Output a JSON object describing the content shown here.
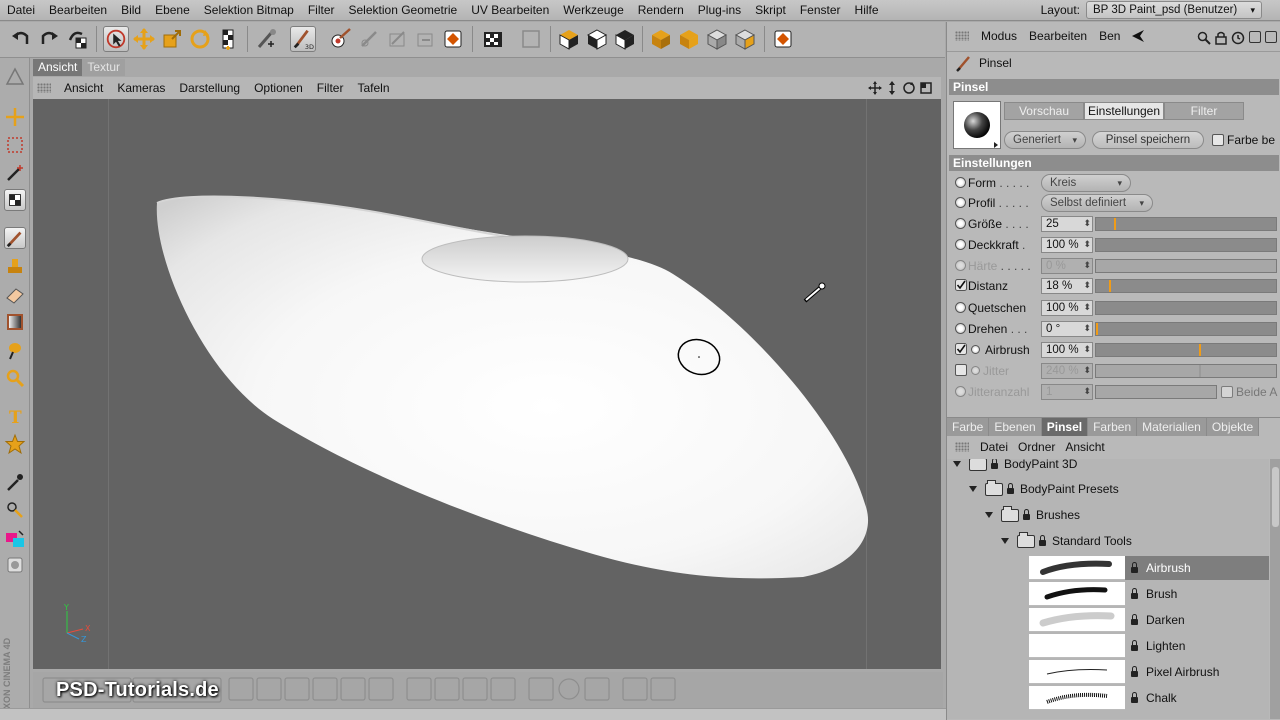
{
  "menubar": {
    "items": [
      "Datei",
      "Bearbeiten",
      "Bild",
      "Ebene",
      "Selektion Bitmap",
      "Filter",
      "Selektion Geometrie",
      "UV Bearbeiten",
      "Werkzeuge",
      "Rendern",
      "Plug-ins",
      "Skript",
      "Fenster",
      "Hilfe"
    ],
    "layout_label": "Layout:",
    "layout_value": "BP 3D Paint_psd (Benutzer)"
  },
  "viewport": {
    "tabs": [
      "Ansicht",
      "Textur"
    ],
    "menu": [
      "Ansicht",
      "Kameras",
      "Darstellung",
      "Optionen",
      "Filter",
      "Tafeln"
    ],
    "axis": {
      "y": "Y",
      "x": "X",
      "z": "Z"
    }
  },
  "left_brand": "MAXON CINEMA 4D",
  "watermark": "PSD-Tutorials.de",
  "attributes": {
    "menu": [
      "Modus",
      "Bearbeiten",
      "Ben"
    ],
    "tool_title": "Pinsel",
    "section_title": "Pinsel",
    "tabs": [
      "Vorschau",
      "Einstellungen",
      "Filter"
    ],
    "generated_dropdown": "Generiert",
    "save_button": "Pinsel speichern",
    "color_checkbox": "Farbe be",
    "settings_title": "Einstellungen",
    "params": {
      "form": {
        "label": "Form",
        "dots": " . . . . .",
        "value": "Kreis"
      },
      "profil": {
        "label": "Profil",
        "dots": " . . . . .",
        "value": "Selbst definiert"
      },
      "groesse": {
        "label": "Größe",
        "dots": " . . . .",
        "value": "25",
        "level": 0.25
      },
      "deckkraft": {
        "label": "Deckkraft",
        "dots": " .",
        "value": "100 %",
        "level": 1.0
      },
      "haerte": {
        "label": "Härte",
        "dots": " . . . . .",
        "value": "0 %"
      },
      "distanz": {
        "label": "Distanz",
        "value": "18 %",
        "level": 0.18
      },
      "quetschen": {
        "label": "Quetschen",
        "value": "100 %",
        "level": 1.0
      },
      "drehen": {
        "label": "Drehen",
        "dots": " . . .",
        "value": "0 °",
        "level": 0.0
      },
      "airbrush": {
        "label": "Airbrush",
        "value": "100 %",
        "level": 1.0
      },
      "jitter": {
        "label": "Jitter",
        "value": "240 %"
      },
      "jitteranzahl": {
        "label": "Jitteranzahl",
        "value": "1",
        "extra": "Beide A"
      }
    }
  },
  "browser": {
    "tabs": [
      "Farbe",
      "Ebenen",
      "Pinsel",
      "Farben",
      "Materialien",
      "Objekte"
    ],
    "active_tab": "Pinsel",
    "menu": [
      "Datei",
      "Ordner",
      "Ansicht"
    ],
    "folders": [
      "BodyPaint 3D",
      "BodyPaint Presets",
      "Brushes",
      "Standard Tools"
    ],
    "brushes": [
      "Airbrush",
      "Brush",
      "Darken",
      "Lighten",
      "Pixel Airbrush",
      "Chalk"
    ],
    "selected_brush": "Airbrush"
  },
  "colors": {
    "accent_slider": "#f09c18",
    "viewport_bg": "#636363"
  }
}
